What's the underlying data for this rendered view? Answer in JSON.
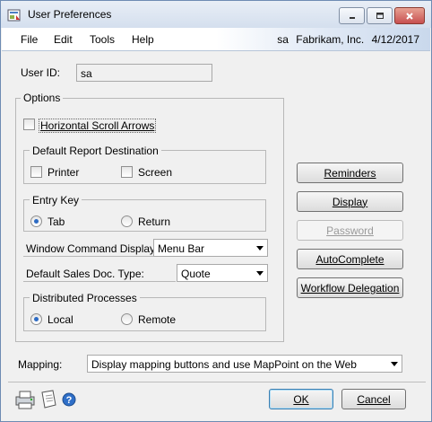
{
  "window": {
    "title": "User Preferences",
    "controls": {
      "minimize": "minimize-icon",
      "maximize": "maximize-icon",
      "close": "close-icon"
    }
  },
  "menu": {
    "items": [
      "File",
      "Edit",
      "Tools",
      "Help"
    ],
    "user": "sa",
    "company": "Fabrikam, Inc.",
    "date": "4/12/2017"
  },
  "user_id": {
    "label": "User ID:",
    "value": "sa"
  },
  "options": {
    "title": "Options",
    "horizontal_scroll_arrows": {
      "label": "Horizontal Scroll Arrows",
      "checked": false
    },
    "report_destination": {
      "title": "Default Report Destination",
      "printer": {
        "label": "Printer",
        "checked": false
      },
      "screen": {
        "label": "Screen",
        "checked": false
      }
    },
    "entry_key": {
      "title": "Entry Key",
      "tab": {
        "label": "Tab",
        "selected": true
      },
      "return": {
        "label": "Return",
        "selected": false
      }
    },
    "window_command_display": {
      "label": "Window Command Display",
      "value": "Menu Bar"
    },
    "default_sales_doc_type": {
      "label": "Default Sales Doc. Type:",
      "value": "Quote"
    },
    "distributed_processes": {
      "title": "Distributed Processes",
      "local": {
        "label": "Local",
        "selected": true
      },
      "remote": {
        "label": "Remote",
        "selected": false
      }
    }
  },
  "side_buttons": {
    "reminders": "Reminders",
    "display": "Display",
    "password": "Password",
    "autocomplete": "AutoComplete",
    "workflow_delegation": "Workflow Delegation"
  },
  "mapping": {
    "label": "Mapping:",
    "value": "Display mapping buttons and use MapPoint on the Web"
  },
  "footer": {
    "ok": "OK",
    "cancel": "Cancel",
    "icons": [
      "printer-icon",
      "note-icon",
      "help-icon"
    ]
  },
  "colors": {
    "accent": "#2d6bc4",
    "titlebar": "#d4dfee"
  }
}
